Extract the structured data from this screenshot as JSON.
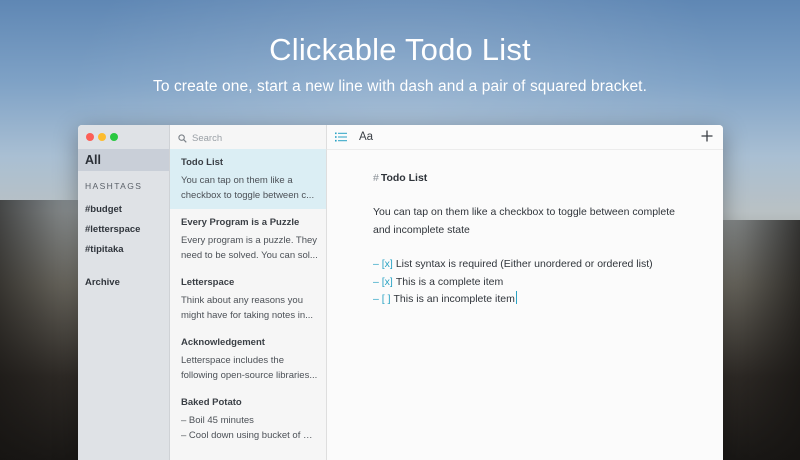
{
  "hero": {
    "title": "Clickable Todo List",
    "subtitle": "To create one, start a new line with dash and a pair of squared bracket."
  },
  "sidebar": {
    "all_label": "All",
    "hashtags_heading": "HASHTAGS",
    "tags": [
      "#budget",
      "#letterspace",
      "#tipitaka"
    ],
    "archive_label": "Archive"
  },
  "search": {
    "placeholder": "Search"
  },
  "notes": [
    {
      "title": "Todo List",
      "lines": [
        "You can tap on them like a",
        "checkbox to toggle between c..."
      ]
    },
    {
      "title": "Every Program is a Puzzle",
      "lines": [
        "Every program is a puzzle. They",
        "need to be solved. You can sol..."
      ]
    },
    {
      "title": "Letterspace",
      "lines": [
        "Think about any reasons you",
        "might have for taking notes in..."
      ]
    },
    {
      "title": "Acknowledgement",
      "lines": [
        "Letterspace includes the",
        "following open-source libraries..."
      ]
    },
    {
      "title": "Baked Potato",
      "lines": [
        "– Boil 45 minutes",
        "– Cool down using bucket of wat..."
      ]
    }
  ],
  "toolbar": {
    "font_label": "Aa"
  },
  "doc": {
    "hash": "#",
    "heading": "Todo List",
    "paragraph_line1": "You can tap on them like a checkbox to toggle between complete",
    "paragraph_line2": "and incomplete state",
    "todos": [
      {
        "mark": "– [x]",
        "text": "List syntax is required (Either unordered or ordered list)"
      },
      {
        "mark": "– [x]",
        "text": "This is a complete item"
      },
      {
        "mark": "– [  ]",
        "text": "This is an incomplete item"
      }
    ]
  },
  "colors": {
    "accent": "#2ba3c4",
    "selected_note": "#dbeef4",
    "sidebar_selected": "#c9cfd8"
  },
  "icons": [
    "list-icon",
    "plus-icon",
    "search-icon"
  ]
}
